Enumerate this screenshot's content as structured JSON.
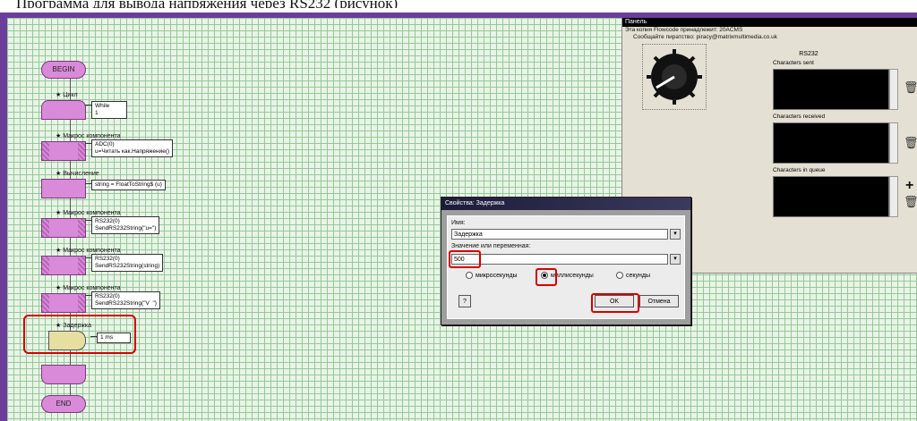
{
  "flowchart": {
    "begin": "BEGIN",
    "end": "END",
    "loop_label": "Цикл",
    "loop_value": "While\n1",
    "blocks": [
      {
        "label": "Макрос компонента",
        "callout": "ADC(0)\nu=Читать как.Напряжение()"
      },
      {
        "label": "Вычисление",
        "callout": "string = FloatToString$ (u)"
      },
      {
        "label": "Макрос компонента",
        "callout": "RS232(0)\nSendRS232String(\"u=\")"
      },
      {
        "label": "Макрос компонента",
        "callout": "RS232(0)\nSendRS232String(string)"
      },
      {
        "label": "Макрос компонента",
        "callout": "RS232(0)\nSendRS232String(\"V  \")"
      }
    ],
    "delay_label": "Задержка",
    "delay_value": "1 ms"
  },
  "panel": {
    "title": "Панель",
    "copy_note": "Эта копия Flowcode принадлежит: 20ACMS",
    "piracy_note": "Сообщайте пиратство: piracy@matrixmultimedia.co.uk",
    "rs232": {
      "title": "RS232",
      "sent_label": "Characters sent",
      "received_label": "Characters received",
      "queue_label": "Characters in queue",
      "plus": "+"
    }
  },
  "dialog": {
    "title": "Свойства: Задержка",
    "name_label": "Имя:",
    "name_value": "Задержка",
    "value_label": "Значение или переменная:",
    "value_value": "500",
    "units": [
      "микросекунды",
      "миллисекунды",
      "секунды"
    ],
    "selected_unit": "миллисекунды",
    "help": "?",
    "ok": "OK",
    "cancel": "Отмена"
  },
  "colors": {
    "frame": "#6a3e9a",
    "grid": "#97c897",
    "block": "#d98ad9",
    "delay": "#e6dfa0",
    "highlight": "#d40000"
  }
}
